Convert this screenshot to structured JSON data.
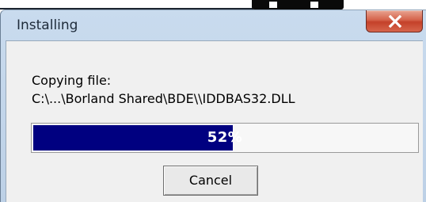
{
  "window": {
    "title": "Installing",
    "close_glyph": "x"
  },
  "body": {
    "copying_label": "Copying file:",
    "file_path": "C:\\...\\Borland Shared\\BDE\\\\IDDBAS32.DLL"
  },
  "progress": {
    "percent": 52,
    "text": "52%"
  },
  "buttons": {
    "cancel": "Cancel"
  },
  "colors": {
    "progress_fill": "#000080",
    "close_button": "#c4412a",
    "frame": "#bcd0e6"
  },
  "icons": {
    "close": "close-icon"
  }
}
